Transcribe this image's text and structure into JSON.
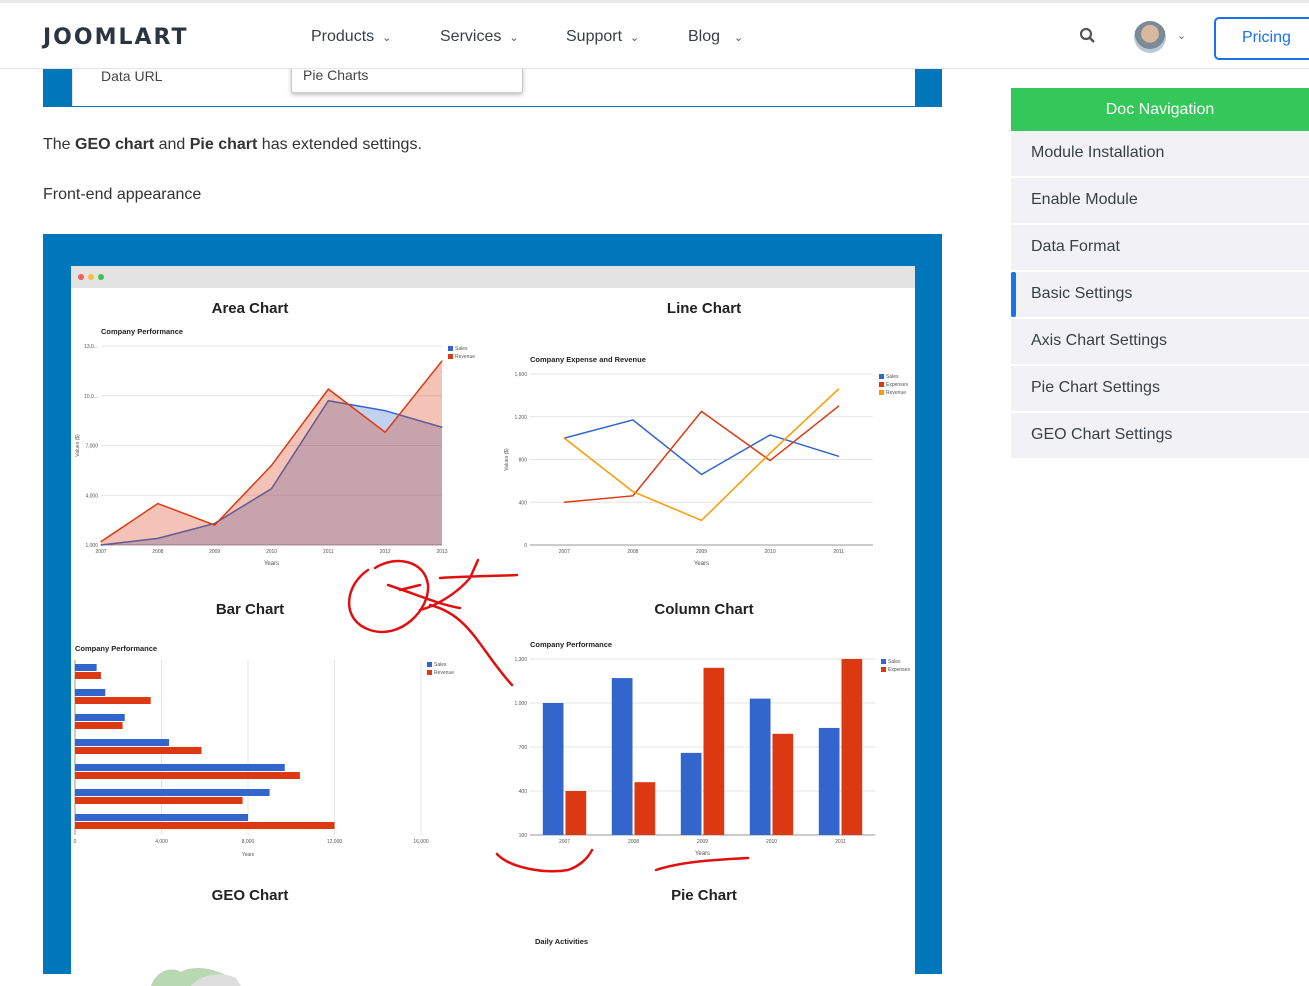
{
  "header": {
    "logo": "JOOMLART",
    "nav": [
      {
        "label": "Products"
      },
      {
        "label": "Services"
      },
      {
        "label": "Support"
      },
      {
        "label": "Blog"
      }
    ],
    "pricing": "Pricing",
    "search_icon": "search-icon",
    "chevron": "⌄"
  },
  "settings_row": {
    "label": "Data URL",
    "dropdown_value": "Pie Charts"
  },
  "content": {
    "intro_parts": [
      "The ",
      "GEO chart",
      " and ",
      "Pie chart",
      " has extended settings."
    ],
    "front_end": "Front-end appearance"
  },
  "sidebar": {
    "title": "Doc Navigation",
    "items": [
      {
        "label": "Module Installation"
      },
      {
        "label": "Enable Module"
      },
      {
        "label": "Data Format"
      },
      {
        "label": "Basic Settings",
        "active": true
      },
      {
        "label": "Axis Chart Settings"
      },
      {
        "label": "Pie Chart Settings"
      },
      {
        "label": "GEO Chart Settings"
      }
    ]
  },
  "colors": {
    "brand_blue": "#0077bb",
    "nav_green": "#34c759",
    "link_blue": "#1a73e8",
    "series_blue": "#3366cc",
    "series_red": "#dc3912",
    "series_orange": "#ff9900",
    "annotation_red": "#e01010"
  },
  "panel_titles": [
    "Area Chart",
    "Line Chart",
    "Bar Chart",
    "Column Chart",
    "GEO Chart",
    "Pie Chart"
  ],
  "chart_data": [
    {
      "type": "area",
      "title": "Company Performance",
      "xlabel": "Years",
      "ylabel": "Values ($)",
      "categories": [
        "2007",
        "2008",
        "2009",
        "2010",
        "2011",
        "2012",
        "2013"
      ],
      "ylim": [
        1000,
        13000
      ],
      "yticks": [
        "1,000",
        "4,000",
        "7,000",
        "10,0...",
        "13,0..."
      ],
      "legend": "right",
      "series": [
        {
          "name": "Sales",
          "values": [
            1000,
            1400,
            2300,
            4400,
            9700,
            9100,
            8100
          ]
        },
        {
          "name": "Revenue",
          "values": [
            1200,
            3500,
            2200,
            5800,
            10400,
            7800,
            12100
          ]
        }
      ]
    },
    {
      "type": "line",
      "title": "Company Expense and Revenue",
      "xlabel": "Years",
      "ylabel": "Values ($)",
      "categories": [
        "2007",
        "2008",
        "2009",
        "2010",
        "2011"
      ],
      "ylim": [
        0,
        1600
      ],
      "yticks": [
        "0",
        "400",
        "800",
        "1,200",
        "1,600"
      ],
      "legend": "right",
      "series": [
        {
          "name": "Sales",
          "values": [
            1000,
            1170,
            660,
            1030,
            830
          ]
        },
        {
          "name": "Expenses",
          "values": [
            400,
            460,
            1250,
            790,
            1300
          ]
        },
        {
          "name": "Revenue",
          "values": [
            1000,
            500,
            230,
            860,
            1460
          ]
        }
      ]
    },
    {
      "type": "bar",
      "title": "Company Performance",
      "xlabel": "Years",
      "xlim": [
        0,
        16000
      ],
      "xticks": [
        "0",
        "4,000",
        "8,000",
        "12,000",
        "16,000"
      ],
      "legend": "right",
      "series": [
        {
          "name": "Sales",
          "values": [
            1000,
            1400,
            2300,
            4350,
            9700,
            9000,
            8000
          ]
        },
        {
          "name": "Revenue",
          "values": [
            1200,
            3500,
            2200,
            5850,
            10400,
            7750,
            12000
          ]
        }
      ]
    },
    {
      "type": "bar",
      "orientation": "vertical",
      "title": "Company Performance",
      "xlabel": "Years",
      "categories": [
        "2007",
        "2008",
        "2009",
        "2010",
        "2011"
      ],
      "ylim": [
        100,
        1300
      ],
      "yticks": [
        "100",
        "400",
        "700",
        "1,000",
        "1,300"
      ],
      "legend": "right",
      "series": [
        {
          "name": "Sales",
          "values": [
            1000,
            1170,
            660,
            1030,
            830
          ]
        },
        {
          "name": "Expenses",
          "values": [
            400,
            460,
            1240,
            790,
            1300
          ]
        }
      ]
    },
    {
      "type": "pie",
      "title": "Daily Activities"
    }
  ]
}
